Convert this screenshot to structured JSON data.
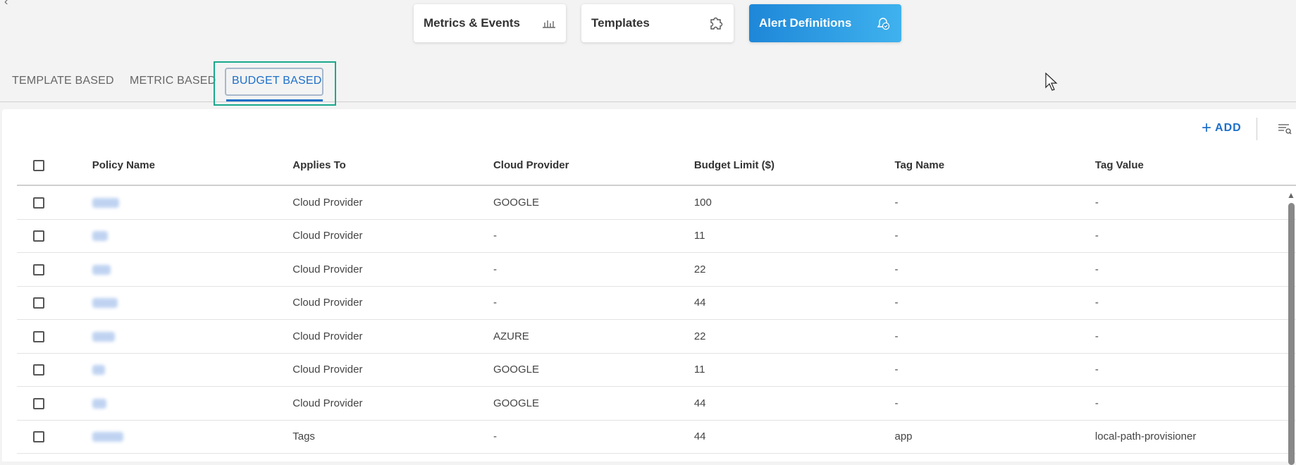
{
  "nav": {
    "metrics_label": "Metrics & Events",
    "templates_label": "Templates",
    "alerts_label": "Alert Definitions",
    "active": "Alert Definitions"
  },
  "tabs": [
    {
      "label": "TEMPLATE BASED"
    },
    {
      "label": "METRIC BASED"
    },
    {
      "label": "BUDGET BASED",
      "active": true
    }
  ],
  "toolbar": {
    "add_label": "ADD"
  },
  "table": {
    "headers": [
      "Policy Name",
      "Applies To",
      "Cloud Provider",
      "Budget Limit ($)",
      "Tag Name",
      "Tag Value"
    ],
    "rows": [
      {
        "applies_to": "Cloud Provider",
        "cloud_provider": "GOOGLE",
        "budget_limit": "100",
        "tag_name": "-",
        "tag_value": "-"
      },
      {
        "applies_to": "Cloud Provider",
        "cloud_provider": "-",
        "budget_limit": "11",
        "tag_name": "-",
        "tag_value": "-"
      },
      {
        "applies_to": "Cloud Provider",
        "cloud_provider": "-",
        "budget_limit": "22",
        "tag_name": "-",
        "tag_value": "-"
      },
      {
        "applies_to": "Cloud Provider",
        "cloud_provider": "-",
        "budget_limit": "44",
        "tag_name": "-",
        "tag_value": "-"
      },
      {
        "applies_to": "Cloud Provider",
        "cloud_provider": "AZURE",
        "budget_limit": "22",
        "tag_name": "-",
        "tag_value": "-"
      },
      {
        "applies_to": "Cloud Provider",
        "cloud_provider": "GOOGLE",
        "budget_limit": "11",
        "tag_name": "-",
        "tag_value": "-"
      },
      {
        "applies_to": "Cloud Provider",
        "cloud_provider": "GOOGLE",
        "budget_limit": "44",
        "tag_name": "-",
        "tag_value": "-"
      },
      {
        "applies_to": "Tags",
        "cloud_provider": "-",
        "budget_limit": "44",
        "tag_name": "app",
        "tag_value": "local-path-provisioner"
      }
    ]
  },
  "colors": {
    "accent": "#1e6fc9",
    "highlight": "#1aa98c"
  }
}
